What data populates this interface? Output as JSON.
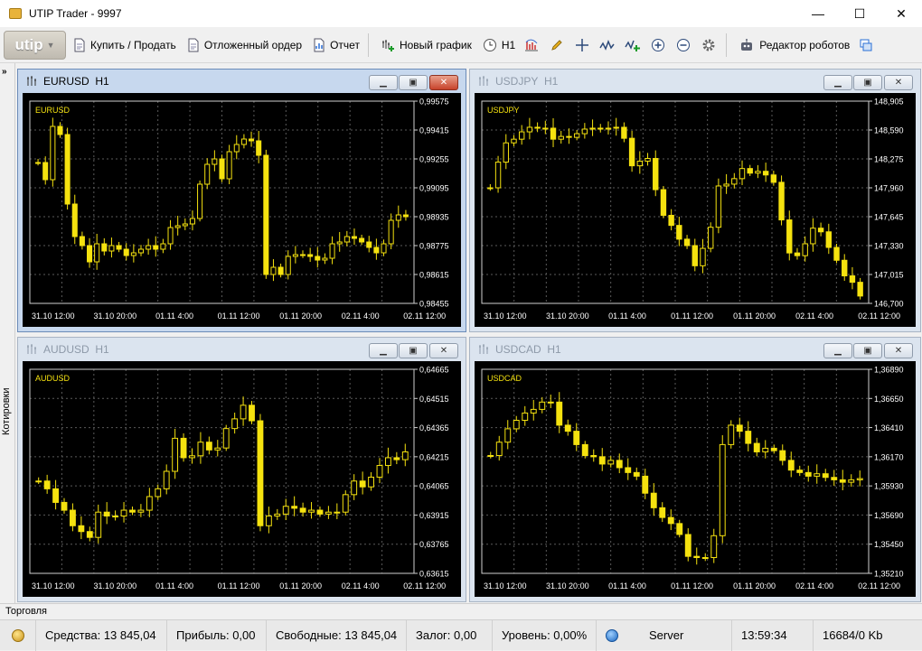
{
  "app": {
    "title": "UTIP Trader - 9997",
    "logo": "utip"
  },
  "window_controls": {
    "minimize": "—",
    "maximize": "☐",
    "close": "✕"
  },
  "toolbar": {
    "buy_sell": "Купить / Продать",
    "pending_order": "Отложенный ордер",
    "report": "Отчет",
    "new_chart": "Новый график",
    "timeframe": "H1",
    "robot_editor": "Редактор роботов",
    "icons": [
      "bar-chart-icon",
      "pencil-icon",
      "crosshair-icon",
      "indicator-icon",
      "indicator-add-icon",
      "zoom-in-icon",
      "zoom-out-icon",
      "gear-icon"
    ]
  },
  "side_panel": {
    "label": "Котировки",
    "expand": "»"
  },
  "bottom_panel": {
    "label": "Торговля"
  },
  "status": {
    "equity": "Средства: 13 845,04",
    "profit": "Прибыль: 0,00",
    "free": "Свободные: 13 845,04",
    "margin": "Залог: 0,00",
    "level": "Уровень: 0,00%",
    "server": "Server",
    "time": "13:59:34",
    "traffic": "16684/0 Kb"
  },
  "charts": [
    {
      "symbol": "EURUSD",
      "timeframe": "H1",
      "active": true,
      "y_ticks": [
        "0,99575",
        "0,99415",
        "0,99255",
        "0,99095",
        "0,98935",
        "0,98775",
        "0,98615",
        "0,98455"
      ],
      "x_ticks": [
        "31.10 12:00",
        "31.10 20:00",
        "01.11 4:00",
        "01.11 12:00",
        "01.11 20:00",
        "02.11 4:00",
        "02.11 12:00"
      ]
    },
    {
      "symbol": "USDJPY",
      "timeframe": "H1",
      "active": false,
      "y_ticks": [
        "148,905",
        "148,590",
        "148,275",
        "147,960",
        "147,645",
        "147,330",
        "147,015",
        "146,700"
      ],
      "x_ticks": [
        "31.10 12:00",
        "31.10 20:00",
        "01.11 4:00",
        "01.11 12:00",
        "01.11 20:00",
        "02.11 4:00",
        "02.11 12:00"
      ]
    },
    {
      "symbol": "AUDUSD",
      "timeframe": "H1",
      "active": false,
      "y_ticks": [
        "0,64665",
        "0,64515",
        "0,64365",
        "0,64215",
        "0,64065",
        "0,63915",
        "0,63765",
        "0,63615"
      ],
      "x_ticks": [
        "31.10 12:00",
        "31.10 20:00",
        "01.11 4:00",
        "01.11 12:00",
        "01.11 20:00",
        "02.11 4:00",
        "02.11 12:00"
      ]
    },
    {
      "symbol": "USDCAD",
      "timeframe": "H1",
      "active": false,
      "y_ticks": [
        "1,36890",
        "1,36650",
        "1,36410",
        "1,36170",
        "1,35930",
        "1,35690",
        "1,35450",
        "1,35210"
      ],
      "x_ticks": [
        "31.10 12:00",
        "31.10 20:00",
        "01.11 4:00",
        "01.11 12:00",
        "01.11 20:00",
        "02.11 4:00",
        "02.11 12:00"
      ]
    }
  ],
  "chart_data": [
    {
      "type": "candlestick",
      "symbol": "EURUSD",
      "timeframe": "H1",
      "ylim": [
        0.98455,
        0.99575
      ],
      "close": [
        0.99235,
        0.9914,
        0.99435,
        0.9939,
        0.99005,
        0.98825,
        0.98775,
        0.98685,
        0.98785,
        0.98745,
        0.98775,
        0.98755,
        0.9872,
        0.98735,
        0.98755,
        0.98775,
        0.98755,
        0.98785,
        0.98875,
        0.98885,
        0.98895,
        0.98925,
        0.99115,
        0.99225,
        0.99255,
        0.99145,
        0.99295,
        0.99335,
        0.99365,
        0.99355,
        0.99275,
        0.98615,
        0.98655,
        0.98615,
        0.98715,
        0.98725,
        0.98725,
        0.98715,
        0.98695,
        0.98705,
        0.98785,
        0.98795,
        0.98825,
        0.98815,
        0.98795,
        0.98765,
        0.98735,
        0.98785,
        0.98915,
        0.98945,
        0.98935
      ]
    },
    {
      "type": "candlestick",
      "symbol": "USDJPY",
      "timeframe": "H1",
      "ylim": [
        146.7,
        148.905
      ],
      "close": [
        147.96,
        148.24,
        148.45,
        148.49,
        148.57,
        148.62,
        148.61,
        148.61,
        148.49,
        148.52,
        148.51,
        148.55,
        148.6,
        148.61,
        148.6,
        148.61,
        148.62,
        148.5,
        148.2,
        148.25,
        148.28,
        147.94,
        147.66,
        147.55,
        147.4,
        147.33,
        147.11,
        147.3,
        147.53,
        147.98,
        148.0,
        148.06,
        148.17,
        148.12,
        148.14,
        148.1,
        148.02,
        147.61,
        147.25,
        147.22,
        147.35,
        147.52,
        147.48,
        147.31,
        147.17,
        147.0,
        146.93,
        146.78
      ]
    },
    {
      "type": "candlestick",
      "symbol": "AUDUSD",
      "timeframe": "H1",
      "ylim": [
        0.63615,
        0.64665
      ],
      "close": [
        0.6409,
        0.6405,
        0.6398,
        0.6394,
        0.6386,
        0.6383,
        0.638,
        0.6393,
        0.6391,
        0.6391,
        0.6394,
        0.6393,
        0.6394,
        0.6401,
        0.6405,
        0.6414,
        0.6431,
        0.6421,
        0.6422,
        0.6429,
        0.6425,
        0.6426,
        0.6436,
        0.6441,
        0.6448,
        0.644,
        0.6386,
        0.6391,
        0.6392,
        0.6396,
        0.6395,
        0.6393,
        0.6394,
        0.6392,
        0.6393,
        0.6393,
        0.6402,
        0.6409,
        0.6406,
        0.6411,
        0.6417,
        0.6421,
        0.642,
        0.6424
      ]
    },
    {
      "type": "candlestick",
      "symbol": "USDCAD",
      "timeframe": "H1",
      "ylim": [
        1.3521,
        1.3689
      ],
      "close": [
        1.3618,
        1.3629,
        1.364,
        1.3647,
        1.3653,
        1.3656,
        1.3662,
        1.3662,
        1.3643,
        1.3638,
        1.3627,
        1.3618,
        1.3617,
        1.3611,
        1.3614,
        1.3608,
        1.3604,
        1.3601,
        1.3587,
        1.3575,
        1.3567,
        1.3562,
        1.3553,
        1.3535,
        1.3534,
        1.3534,
        1.3552,
        1.3627,
        1.3643,
        1.3638,
        1.3628,
        1.3621,
        1.3624,
        1.3622,
        1.3614,
        1.3606,
        1.3604,
        1.3601,
        1.3603,
        1.36,
        1.3598,
        1.3596,
        1.3598,
        1.3599
      ]
    }
  ]
}
